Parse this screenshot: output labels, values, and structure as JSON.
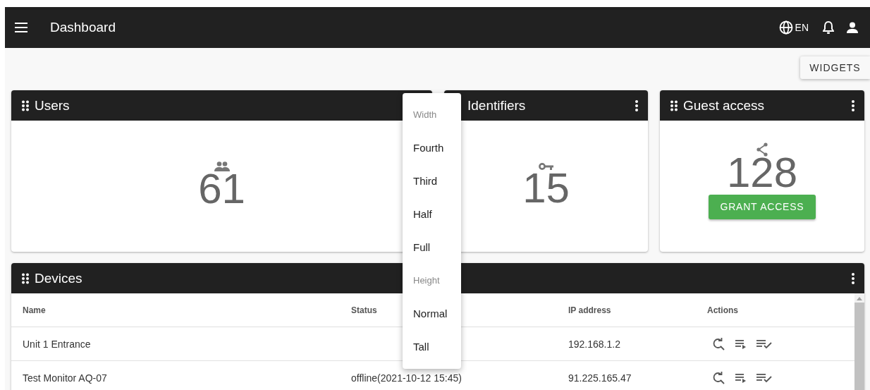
{
  "app_bar": {
    "title": "Dashboard",
    "language": "EN"
  },
  "widgets_button": "WIDGETS",
  "cards": [
    {
      "kind": "users",
      "title": "Users",
      "value": "61",
      "drag_handle": true,
      "menu_button": false
    },
    {
      "kind": "identifiers",
      "title": "Identifiers",
      "value": "15",
      "drag_handle": false,
      "menu_button": true
    },
    {
      "kind": "guest",
      "title": "Guest access",
      "value": "128",
      "drag_handle": true,
      "menu_button": true,
      "action": "GRANT ACCESS"
    }
  ],
  "devices": {
    "title": "Devices",
    "columns": [
      "Name",
      "Status",
      "IP address",
      "Actions"
    ],
    "rows": [
      {
        "name": "Unit 1 Entrance",
        "status": "",
        "ip": "192.168.1.2"
      },
      {
        "name": "Test Monitor AQ-07",
        "status": "offline(2021-10-12 15:45)",
        "ip": "91.225.165.47"
      }
    ]
  },
  "size_menu": [
    {
      "kind": "header",
      "label": "Width"
    },
    {
      "kind": "option",
      "label": "Fourth"
    },
    {
      "kind": "option",
      "label": "Third"
    },
    {
      "kind": "option",
      "label": "Half"
    },
    {
      "kind": "option",
      "label": "Full"
    },
    {
      "kind": "header",
      "label": "Height"
    },
    {
      "kind": "option",
      "label": "Normal"
    },
    {
      "kind": "option",
      "label": "Tall"
    }
  ]
}
